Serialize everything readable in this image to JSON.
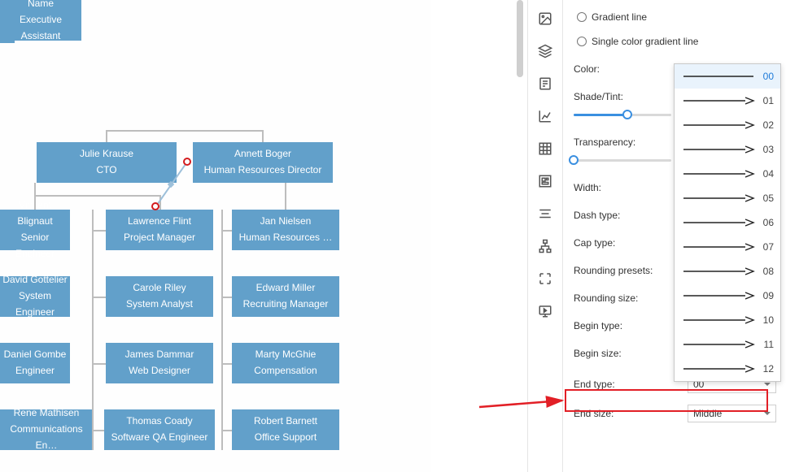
{
  "chart": {
    "top_small": {
      "line1": "",
      "line2": ""
    },
    "head": {
      "line1": "Name",
      "line2": "Executive Assistant"
    },
    "julie": {
      "line1": "Julie Krause",
      "line2": "CTO"
    },
    "annett": {
      "line1": "Annett Boger",
      "line2": "Human Resources Director"
    },
    "vincent": {
      "line1": "Vincent Blignaut",
      "line2": "Senior Engineer"
    },
    "lawrence": {
      "line1": "Lawrence Flint",
      "line2": "Project Manager"
    },
    "jan": {
      "line1": "Jan Nielsen",
      "line2": "Human Resources …"
    },
    "david": {
      "line1": "David Gottelier",
      "line2": "System Engineer"
    },
    "carole": {
      "line1": "Carole Riley",
      "line2": "System Analyst"
    },
    "edward": {
      "line1": "Edward Miller",
      "line2": "Recruiting Manager"
    },
    "daniel": {
      "line1": "Daniel Gombe",
      "line2": "Engineer"
    },
    "james": {
      "line1": "James Dammar",
      "line2": "Web Designer"
    },
    "marty": {
      "line1": "Marty McGhie",
      "line2": "Compensation"
    },
    "rene": {
      "line1": "Rene Mathisen",
      "line2": "Communications En…"
    },
    "thomas": {
      "line1": "Thomas Coady",
      "line2": "Software QA Engineer"
    },
    "robert": {
      "line1": "Robert Barnett",
      "line2": "Office Support"
    }
  },
  "panel": {
    "radio_gradient": "Gradient line",
    "radio_single": "Single color gradient line",
    "color_label": "Color:",
    "shade_label": "Shade/Tint:",
    "transparency_label": "Transparency:",
    "width_label": "Width:",
    "dash_label": "Dash type:",
    "cap_label": "Cap type:",
    "rounding_presets_label": "Rounding presets:",
    "rounding_size_label": "Rounding size:",
    "begin_type_label": "Begin type:",
    "begin_size_label": "Begin size:",
    "end_type_label": "End type:",
    "end_type_value": "00",
    "end_size_label": "End size:",
    "end_size_value": "Middle"
  },
  "flyout": {
    "items": [
      {
        "num": "00",
        "selected": true,
        "arrow": false
      },
      {
        "num": "01",
        "selected": false,
        "arrow": true
      },
      {
        "num": "02",
        "selected": false,
        "arrow": true
      },
      {
        "num": "03",
        "selected": false,
        "arrow": true
      },
      {
        "num": "04",
        "selected": false,
        "arrow": true
      },
      {
        "num": "05",
        "selected": false,
        "arrow": true
      },
      {
        "num": "06",
        "selected": false,
        "arrow": true
      },
      {
        "num": "07",
        "selected": false,
        "arrow": true
      },
      {
        "num": "08",
        "selected": false,
        "arrow": true
      },
      {
        "num": "09",
        "selected": false,
        "arrow": true
      },
      {
        "num": "10",
        "selected": false,
        "arrow": true
      },
      {
        "num": "11",
        "selected": false,
        "arrow": true
      },
      {
        "num": "12",
        "selected": false,
        "arrow": true
      }
    ]
  }
}
